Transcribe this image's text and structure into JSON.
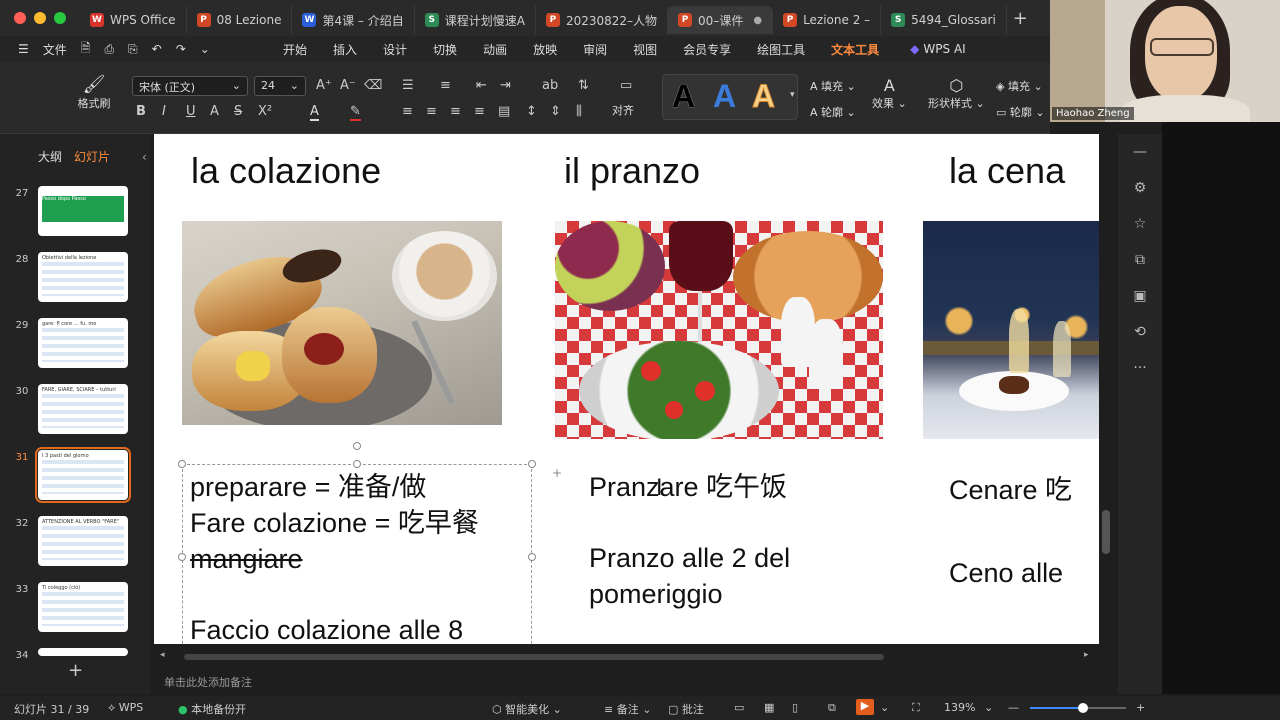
{
  "tabs": [
    {
      "label": "WPS Office",
      "icon": "W",
      "color": "#d9342b"
    },
    {
      "label": "08 Lezione",
      "icon": "P",
      "color": "#d24726"
    },
    {
      "label": "第4课 – 介绍自",
      "icon": "W",
      "color": "#2b5fd9"
    },
    {
      "label": "课程计划慢速A",
      "icon": "S",
      "color": "#2e8b57"
    },
    {
      "label": "20230822–人物",
      "icon": "P",
      "color": "#d24726"
    },
    {
      "label": "00–课件",
      "icon": "P",
      "color": "#d24726"
    },
    {
      "label": "Lezione 2 –",
      "icon": "P",
      "color": "#d24726"
    },
    {
      "label": "5494_Glossari",
      "icon": "S",
      "color": "#2e8b57"
    }
  ],
  "menu": {
    "file": "文件",
    "items": [
      "开始",
      "插入",
      "设计",
      "切换",
      "动画",
      "放映",
      "审阅",
      "视图",
      "会员专享",
      "绘图工具",
      "文本工具"
    ],
    "active": "文本工具",
    "ai": "WPS AI"
  },
  "ribbon": {
    "format_painter": "格式刷",
    "font": "宋体 (正文)",
    "size": "24",
    "align": "对齐",
    "fill": "填充",
    "outline": "轮廓",
    "effect": "效果",
    "shape_style": "形状样式",
    "fill2": "填充",
    "outline2": "轮廓"
  },
  "webcam": {
    "name": "Haohao Zheng"
  },
  "left_panel": {
    "tab_outline": "大纲",
    "tab_slides": "幻灯片",
    "thumbs": [
      {
        "num": "27",
        "caption": "慢速意大利语 A1–A2 ITALIANO Passo dopo Passo"
      },
      {
        "num": "28",
        "caption": "Obiettivi della lezione"
      },
      {
        "num": "29",
        "caption": "gare: fl core … fu. mo"
      },
      {
        "num": "30",
        "caption": "FARE, GIARE, SCIARE – tutturi"
      },
      {
        "num": "31",
        "caption": "I 3 pasti del giorno"
      },
      {
        "num": "32",
        "caption": "ATTENZIONE AL VERBO \"FARE\""
      },
      {
        "num": "33",
        "caption": "Ti coleggo (ciò)"
      },
      {
        "num": "34",
        "caption": ""
      }
    ]
  },
  "slide": {
    "h1": "la colazione",
    "h2": "il pranzo",
    "h3": "la cena",
    "c1_line1": "preparare = 准备/做",
    "c1_line2": "Fare colazione = 吃早餐",
    "c1_line3": "mangiare",
    "c1_line4": "Faccio colazione alle 8",
    "c2_line1": "Pranzare 吃午饭",
    "c2_line2": "Pranzo alle 2 del",
    "c2_line3": "pomeriggio",
    "c3_line1": "Cenare 吃",
    "c3_line2": "Ceno alle"
  },
  "notes_placeholder": "单击此处添加备注",
  "status": {
    "slide_count": "幻灯片 31 / 39",
    "wps": "WPS",
    "backup": "本地备份开",
    "beautify": "智能美化",
    "notes": "备注",
    "comments": "批注",
    "zoom": "139%",
    "zoom_fraction": 0.55
  }
}
